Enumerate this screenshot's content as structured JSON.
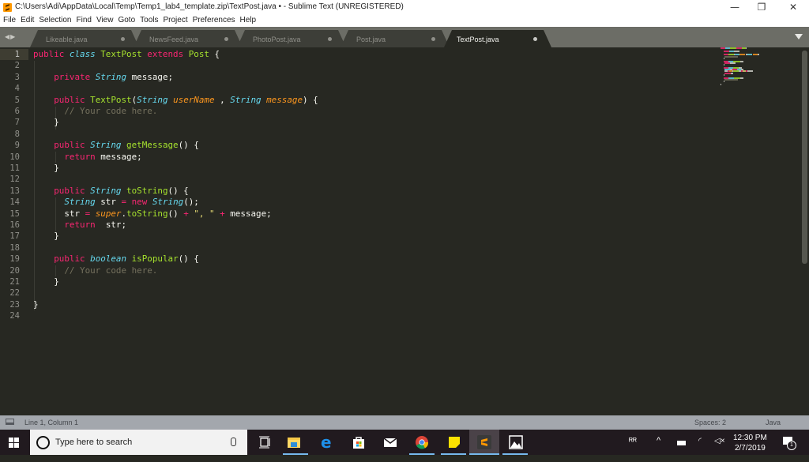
{
  "window": {
    "title": "C:\\Users\\Adi\\AppData\\Local\\Temp\\Temp1_lab4_template.zip\\TextPost.java • - Sublime Text (UNREGISTERED)",
    "minimize": "—",
    "maximize": "❐",
    "close": "✕"
  },
  "menu": [
    "File",
    "Edit",
    "Selection",
    "Find",
    "View",
    "Goto",
    "Tools",
    "Project",
    "Preferences",
    "Help"
  ],
  "tabs": {
    "nav": "◀▶",
    "items": [
      {
        "label": "Likeable.java",
        "dirty": true,
        "active": false
      },
      {
        "label": "NewsFeed.java",
        "dirty": true,
        "active": false
      },
      {
        "label": "PhotoPost.java",
        "dirty": true,
        "active": false
      },
      {
        "label": "Post.java",
        "dirty": true,
        "active": false
      },
      {
        "label": "TextPost.java",
        "dirty": true,
        "active": true
      }
    ]
  },
  "editor": {
    "current_line": 1,
    "line_numbers": [
      "1",
      "2",
      "3",
      "4",
      "5",
      "6",
      "7",
      "8",
      "9",
      "10",
      "11",
      "12",
      "13",
      "14",
      "15",
      "16",
      "17",
      "18",
      "19",
      "20",
      "21",
      "22",
      "23",
      "24"
    ],
    "lines": [
      [
        [
          "kw",
          "public "
        ],
        [
          "ty",
          "class "
        ],
        [
          "fn",
          "TextPost "
        ],
        [
          "kw",
          "extends "
        ],
        [
          "fn",
          "Post "
        ],
        [
          "",
          "{"
        ]
      ],
      [],
      [
        [
          "",
          "    "
        ],
        [
          "kw",
          "private "
        ],
        [
          "ty",
          "String "
        ],
        [
          "",
          "message;"
        ]
      ],
      [],
      [
        [
          "",
          "    "
        ],
        [
          "kw",
          "public "
        ],
        [
          "fn",
          "TextPost"
        ],
        [
          "",
          "("
        ],
        [
          "ty",
          "String "
        ],
        [
          "pa",
          "userName"
        ],
        [
          "",
          " , "
        ],
        [
          "ty",
          "String "
        ],
        [
          "pa",
          "message"
        ],
        [
          "",
          ") {"
        ]
      ],
      [
        [
          "",
          "      "
        ],
        [
          "cm",
          "// Your code here."
        ]
      ],
      [
        [
          "",
          "    }"
        ]
      ],
      [],
      [
        [
          "",
          "    "
        ],
        [
          "kw",
          "public "
        ],
        [
          "ty",
          "String "
        ],
        [
          "fn",
          "getMessage"
        ],
        [
          "",
          "() {"
        ]
      ],
      [
        [
          "",
          "      "
        ],
        [
          "kw",
          "return "
        ],
        [
          "",
          "message;"
        ]
      ],
      [
        [
          "",
          "    }"
        ]
      ],
      [],
      [
        [
          "",
          "    "
        ],
        [
          "kw",
          "public "
        ],
        [
          "ty",
          "String "
        ],
        [
          "fn",
          "toString"
        ],
        [
          "",
          "() {"
        ]
      ],
      [
        [
          "",
          "      "
        ],
        [
          "ty",
          "String "
        ],
        [
          "",
          "str "
        ],
        [
          "kw",
          "= "
        ],
        [
          "kw",
          "new "
        ],
        [
          "ty",
          "String"
        ],
        [
          "",
          "();"
        ]
      ],
      [
        [
          "",
          "      str "
        ],
        [
          "kw",
          "= "
        ],
        [
          "pa",
          "super"
        ],
        [
          "",
          "."
        ],
        [
          "fn",
          "toString"
        ],
        [
          "",
          "() "
        ],
        [
          "kw",
          "+ "
        ],
        [
          "st",
          "\", \" "
        ],
        [
          "kw",
          "+ "
        ],
        [
          "",
          "message;"
        ]
      ],
      [
        [
          "",
          "      "
        ],
        [
          "kw",
          "return  "
        ],
        [
          "",
          "str;"
        ]
      ],
      [
        [
          "",
          "    }"
        ]
      ],
      [],
      [
        [
          "",
          "    "
        ],
        [
          "kw",
          "public "
        ],
        [
          "ty",
          "boolean "
        ],
        [
          "fn",
          "isPopular"
        ],
        [
          "",
          "() {"
        ]
      ],
      [
        [
          "",
          "      "
        ],
        [
          "cm",
          "// Your code here."
        ]
      ],
      [
        [
          "",
          "    }"
        ]
      ],
      [],
      [
        [
          "",
          "}"
        ]
      ],
      []
    ]
  },
  "status": {
    "position": "Line 1, Column 1",
    "spaces": "Spaces: 2",
    "syntax": "Java"
  },
  "taskbar": {
    "search_placeholder": "Type here to search",
    "apps": [
      "task-view",
      "file-explorer",
      "edge",
      "store",
      "mail",
      "chrome",
      "sticky-notes",
      "sublime-text",
      "photos"
    ],
    "time": "12:30 PM",
    "date": "2/7/2019",
    "notification_count": "1"
  },
  "colors": {
    "keyword": "#f92672",
    "type": "#66d9ef",
    "function": "#a6e22e",
    "parameter": "#fd971f",
    "comment": "#75715e",
    "string": "#e6db74",
    "background": "#272822"
  }
}
